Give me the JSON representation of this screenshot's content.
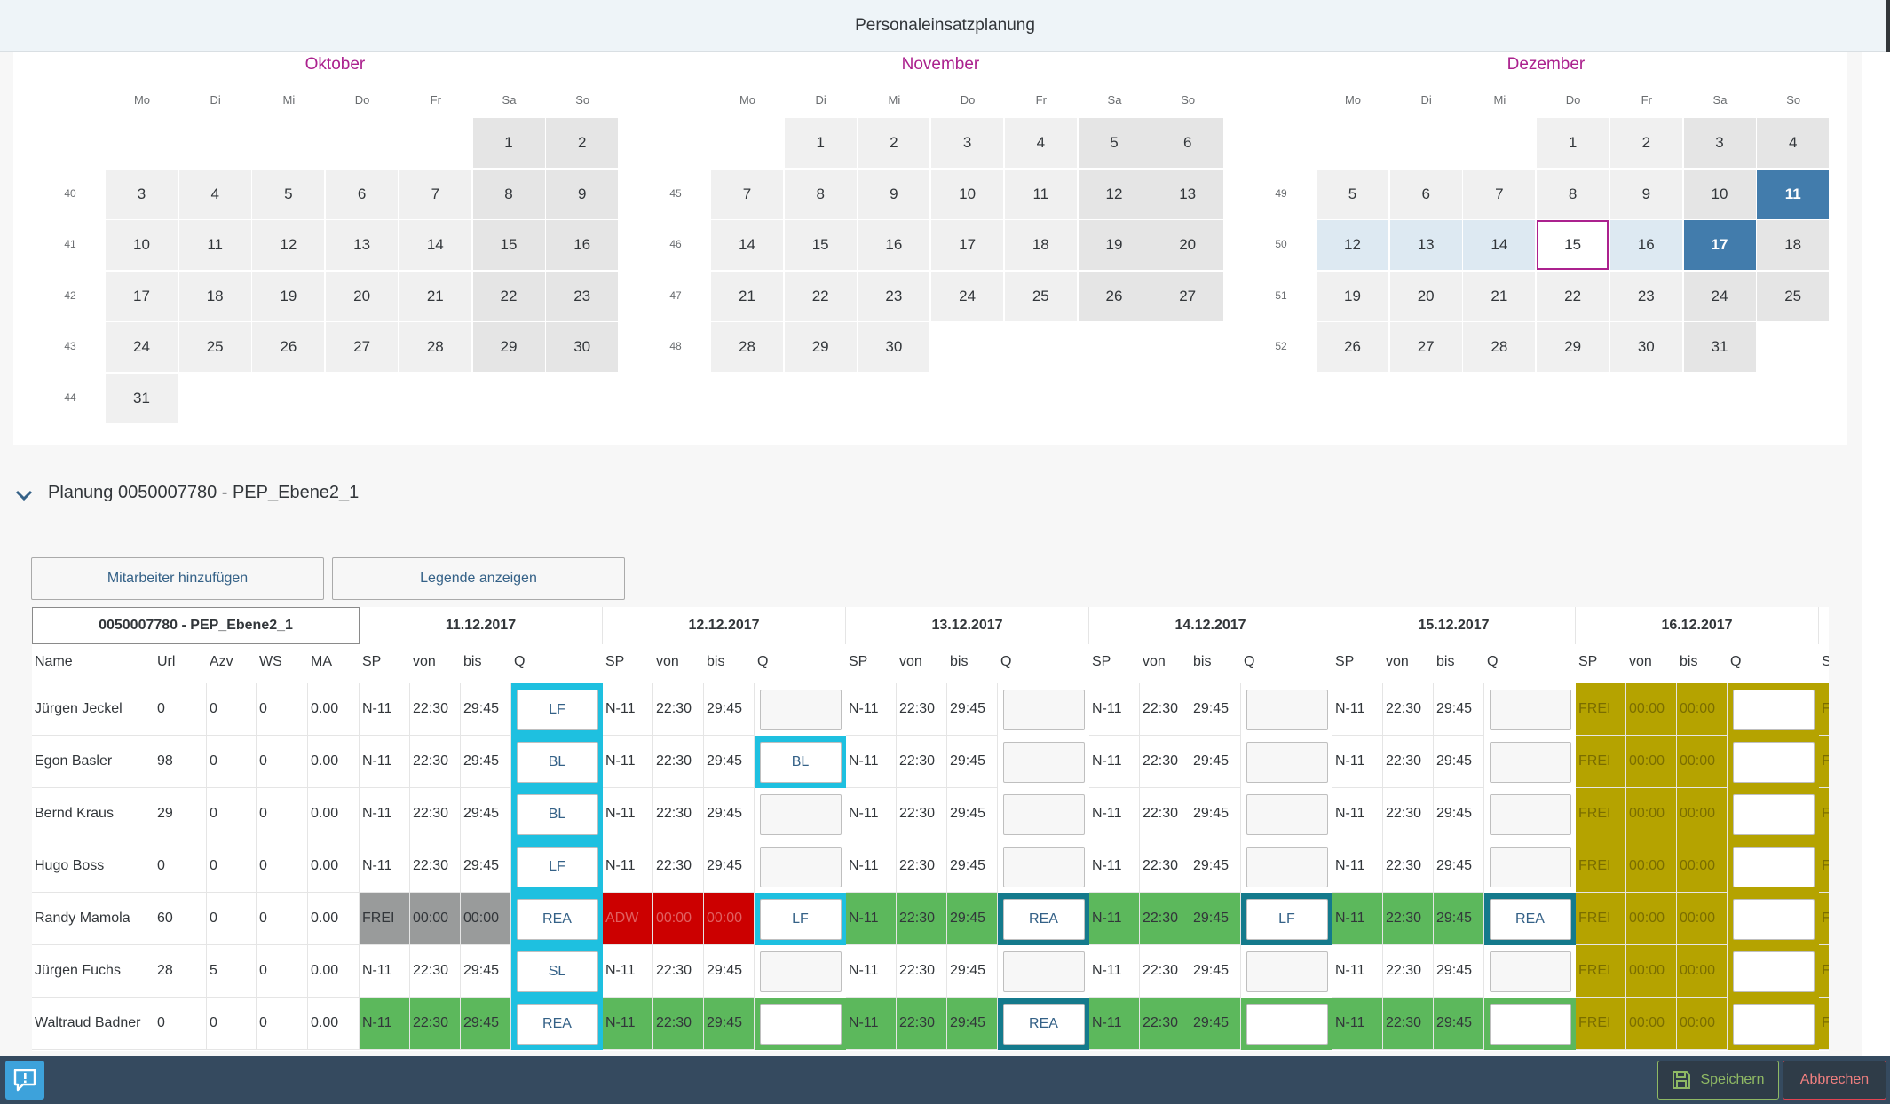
{
  "shell": {
    "title": "Personaleinsatzplanung"
  },
  "calendar": {
    "weekdays": [
      "Mo",
      "Di",
      "Mi",
      "Do",
      "Fr",
      "Sa",
      "So"
    ],
    "months": [
      {
        "name": "Oktober",
        "first_col": 6,
        "days": 31,
        "weeks": [
          "40",
          "41",
          "42",
          "43",
          "44"
        ]
      },
      {
        "name": "November",
        "first_col": 2,
        "days": 30,
        "weeks": [
          "45",
          "46",
          "47",
          "48"
        ]
      },
      {
        "name": "Dezember",
        "first_col": 4,
        "days": 31,
        "weeks": [
          "49",
          "50",
          "51",
          "52"
        ]
      }
    ],
    "selected_range": {
      "month": "Dezember",
      "start": 11,
      "end": 17
    },
    "today": {
      "month": "Dezember",
      "day": 15
    }
  },
  "panel": {
    "title": "Planung 0050007780 - PEP_Ebene2_1"
  },
  "toolbar": {
    "add_employee": "Mitarbeiter hinzufügen",
    "show_legend": "Legende anzeigen"
  },
  "table": {
    "org_header": "0050007780 - PEP_Ebene2_1",
    "columns": [
      "Name",
      "Url",
      "Azv",
      "WS",
      "MA"
    ],
    "day_columns": [
      "SP",
      "von",
      "bis",
      "Q"
    ],
    "dates": [
      "11.12.2017",
      "12.12.2017",
      "13.12.2017",
      "14.12.2017",
      "15.12.2017",
      "16.12.2017"
    ],
    "colors": {
      "green": "#5cb85c",
      "grey": "#999b9b",
      "red": "#cc0000",
      "olive": "#b5a300",
      "cyan": "#1ec0e0",
      "teal": "#147a8c"
    },
    "rows": [
      {
        "name": "Jürgen Jeckel",
        "url": "0",
        "azv": "0",
        "ws": "0",
        "ma": "0.00",
        "days": [
          {
            "sp": "N-11",
            "von": "22:30",
            "bis": "29:45",
            "q": "LF",
            "bg": "",
            "qframe": "cyan"
          },
          {
            "sp": "N-11",
            "von": "22:30",
            "bis": "29:45",
            "q": "",
            "bg": "",
            "qframe": ""
          },
          {
            "sp": "N-11",
            "von": "22:30",
            "bis": "29:45",
            "q": "",
            "bg": "",
            "qframe": ""
          },
          {
            "sp": "N-11",
            "von": "22:30",
            "bis": "29:45",
            "q": "",
            "bg": "",
            "qframe": ""
          },
          {
            "sp": "N-11",
            "von": "22:30",
            "bis": "29:45",
            "q": "",
            "bg": "",
            "qframe": ""
          },
          {
            "sp": "FREI",
            "von": "00:00",
            "bis": "00:00",
            "q": "",
            "bg": "olive",
            "qframe": "olive"
          }
        ]
      },
      {
        "name": "Egon Basler",
        "url": "98",
        "azv": "0",
        "ws": "0",
        "ma": "0.00",
        "days": [
          {
            "sp": "N-11",
            "von": "22:30",
            "bis": "29:45",
            "q": "BL",
            "bg": "",
            "qframe": "cyan"
          },
          {
            "sp": "N-11",
            "von": "22:30",
            "bis": "29:45",
            "q": "BL",
            "bg": "",
            "qframe": "cyan"
          },
          {
            "sp": "N-11",
            "von": "22:30",
            "bis": "29:45",
            "q": "",
            "bg": "",
            "qframe": ""
          },
          {
            "sp": "N-11",
            "von": "22:30",
            "bis": "29:45",
            "q": "",
            "bg": "",
            "qframe": ""
          },
          {
            "sp": "N-11",
            "von": "22:30",
            "bis": "29:45",
            "q": "",
            "bg": "",
            "qframe": ""
          },
          {
            "sp": "FREI",
            "von": "00:00",
            "bis": "00:00",
            "q": "",
            "bg": "olive",
            "qframe": "olive"
          }
        ]
      },
      {
        "name": "Bernd Kraus",
        "url": "29",
        "azv": "0",
        "ws": "0",
        "ma": "0.00",
        "days": [
          {
            "sp": "N-11",
            "von": "22:30",
            "bis": "29:45",
            "q": "BL",
            "bg": "",
            "qframe": "cyan"
          },
          {
            "sp": "N-11",
            "von": "22:30",
            "bis": "29:45",
            "q": "",
            "bg": "",
            "qframe": ""
          },
          {
            "sp": "N-11",
            "von": "22:30",
            "bis": "29:45",
            "q": "",
            "bg": "",
            "qframe": ""
          },
          {
            "sp": "N-11",
            "von": "22:30",
            "bis": "29:45",
            "q": "",
            "bg": "",
            "qframe": ""
          },
          {
            "sp": "N-11",
            "von": "22:30",
            "bis": "29:45",
            "q": "",
            "bg": "",
            "qframe": ""
          },
          {
            "sp": "FREI",
            "von": "00:00",
            "bis": "00:00",
            "q": "",
            "bg": "olive",
            "qframe": "olive"
          }
        ]
      },
      {
        "name": "Hugo Boss",
        "url": "0",
        "azv": "0",
        "ws": "0",
        "ma": "0.00",
        "days": [
          {
            "sp": "N-11",
            "von": "22:30",
            "bis": "29:45",
            "q": "LF",
            "bg": "",
            "qframe": "cyan"
          },
          {
            "sp": "N-11",
            "von": "22:30",
            "bis": "29:45",
            "q": "",
            "bg": "",
            "qframe": ""
          },
          {
            "sp": "N-11",
            "von": "22:30",
            "bis": "29:45",
            "q": "",
            "bg": "",
            "qframe": ""
          },
          {
            "sp": "N-11",
            "von": "22:30",
            "bis": "29:45",
            "q": "",
            "bg": "",
            "qframe": ""
          },
          {
            "sp": "N-11",
            "von": "22:30",
            "bis": "29:45",
            "q": "",
            "bg": "",
            "qframe": ""
          },
          {
            "sp": "FREI",
            "von": "00:00",
            "bis": "00:00",
            "q": "",
            "bg": "olive",
            "qframe": "olive"
          }
        ]
      },
      {
        "name": "Randy Mamola",
        "url": "60",
        "azv": "0",
        "ws": "0",
        "ma": "0.00",
        "days": [
          {
            "sp": "FREI",
            "von": "00:00",
            "bis": "00:00",
            "q": "REA",
            "bg": "grey",
            "qframe": "cyan"
          },
          {
            "sp": "ADW",
            "von": "00:00",
            "bis": "00:00",
            "q": "LF",
            "bg": "red",
            "qframe": "cyan"
          },
          {
            "sp": "N-11",
            "von": "22:30",
            "bis": "29:45",
            "q": "REA",
            "bg": "green",
            "qframe": "teal"
          },
          {
            "sp": "N-11",
            "von": "22:30",
            "bis": "29:45",
            "q": "LF",
            "bg": "green",
            "qframe": "teal"
          },
          {
            "sp": "N-11",
            "von": "22:30",
            "bis": "29:45",
            "q": "REA",
            "bg": "green",
            "qframe": "teal"
          },
          {
            "sp": "FREI",
            "von": "00:00",
            "bis": "00:00",
            "q": "",
            "bg": "olive",
            "qframe": "olive"
          }
        ]
      },
      {
        "name": "Jürgen Fuchs",
        "url": "28",
        "azv": "5",
        "ws": "0",
        "ma": "0.00",
        "days": [
          {
            "sp": "N-11",
            "von": "22:30",
            "bis": "29:45",
            "q": "SL",
            "bg": "",
            "qframe": "cyan"
          },
          {
            "sp": "N-11",
            "von": "22:30",
            "bis": "29:45",
            "q": "",
            "bg": "",
            "qframe": ""
          },
          {
            "sp": "N-11",
            "von": "22:30",
            "bis": "29:45",
            "q": "",
            "bg": "",
            "qframe": ""
          },
          {
            "sp": "N-11",
            "von": "22:30",
            "bis": "29:45",
            "q": "",
            "bg": "",
            "qframe": ""
          },
          {
            "sp": "N-11",
            "von": "22:30",
            "bis": "29:45",
            "q": "",
            "bg": "",
            "qframe": ""
          },
          {
            "sp": "FREI",
            "von": "00:00",
            "bis": "00:00",
            "q": "",
            "bg": "olive",
            "qframe": "olive"
          }
        ]
      },
      {
        "name": "Waltraud Badner",
        "url": "0",
        "azv": "0",
        "ws": "0",
        "ma": "0.00",
        "days": [
          {
            "sp": "N-11",
            "von": "22:30",
            "bis": "29:45",
            "q": "REA",
            "bg": "green",
            "qframe": "cyan"
          },
          {
            "sp": "N-11",
            "von": "22:30",
            "bis": "29:45",
            "q": "",
            "bg": "green",
            "qframe": "green"
          },
          {
            "sp": "N-11",
            "von": "22:30",
            "bis": "29:45",
            "q": "REA",
            "bg": "green",
            "qframe": "teal"
          },
          {
            "sp": "N-11",
            "von": "22:30",
            "bis": "29:45",
            "q": "",
            "bg": "green",
            "qframe": "green"
          },
          {
            "sp": "N-11",
            "von": "22:30",
            "bis": "29:45",
            "q": "",
            "bg": "green",
            "qframe": "green"
          },
          {
            "sp": "FREI",
            "von": "00:00",
            "bis": "00:00",
            "q": "",
            "bg": "olive",
            "qframe": "olive"
          }
        ]
      }
    ]
  },
  "footer": {
    "save_label": "Speichern",
    "cancel_label": "Abbrechen"
  }
}
